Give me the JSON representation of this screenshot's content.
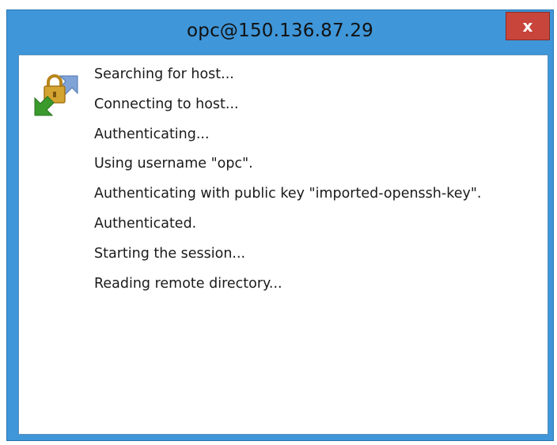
{
  "window": {
    "title": "opc@150.136.87.29",
    "close_label": "x"
  },
  "icon": "secure-connection-arrows-lock-icon",
  "log": [
    "Searching for host...",
    "Connecting to host...",
    "Authenticating...",
    "Using username \"opc\".",
    "Authenticating with public key \"imported-openssh-key\".",
    "Authenticated.",
    "Starting the session...",
    "Reading remote directory..."
  ],
  "colors": {
    "titlebar": "#3f96d8",
    "close_button": "#c8453b",
    "arrow_green": "#3a9a2c",
    "arrow_blue": "#7fa3d6",
    "lock_gold": "#d4a431"
  }
}
